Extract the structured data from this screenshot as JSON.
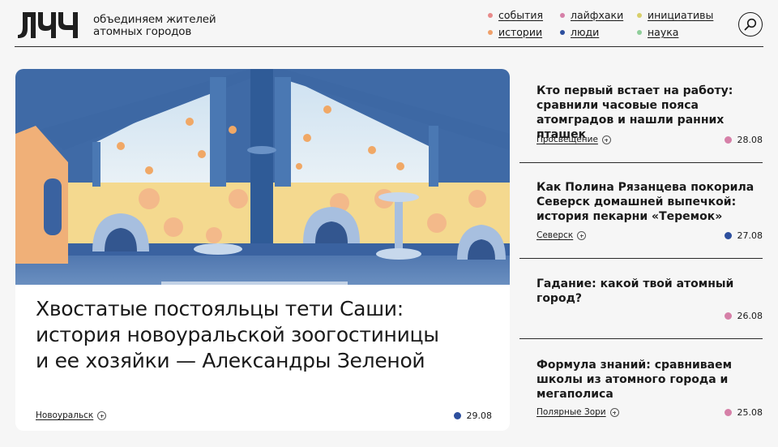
{
  "header": {
    "logo_text": "ЛУЧ",
    "tagline_line1": "объединяем жителей",
    "tagline_line2": "атомных городов",
    "nav": [
      {
        "label": "события",
        "dot_color": "#e88a8a"
      },
      {
        "label": "лайфхаки",
        "dot_color": "#d680a8"
      },
      {
        "label": "инициативы",
        "dot_color": "#d8cf6a"
      },
      {
        "label": "истории",
        "dot_color": "#f0a06a"
      },
      {
        "label": "люди",
        "dot_color": "#2d4f9e"
      },
      {
        "label": "наука",
        "dot_color": "#8fce9a"
      }
    ],
    "search_icon": "search-icon"
  },
  "main_article": {
    "title": "Хвостатые постояльцы тети Саши: история новоуральской зоогостиницы и ее хозяйки — Александры Зеленой",
    "tag": "Новоуральск",
    "date": "29.08",
    "date_dot_color": "#2d4f9e",
    "image": "illustration of a cat hotel room with paw prints on windows"
  },
  "articles": [
    {
      "title": "Кто первый встает на работу: сравнили часовые пояса атомградов и нашли ранних пташек",
      "tag": "Просвещение",
      "date": "28.08",
      "date_dot_color": "#d680a8"
    },
    {
      "title": "Как Полина Рязанцева покорила Северск домашней выпечкой: история пекарни «Теремок»",
      "tag": "Северск",
      "date": "27.08",
      "date_dot_color": "#2d4f9e"
    },
    {
      "title": "Гадание: какой твой атомный город?",
      "tag": "",
      "date": "26.08",
      "date_dot_color": "#d680a8"
    },
    {
      "title": "Формула знаний: сравниваем школы из атомного города и мегаполиса",
      "tag": "Полярные Зори",
      "date": "25.08",
      "date_dot_color": "#d680a8"
    }
  ]
}
